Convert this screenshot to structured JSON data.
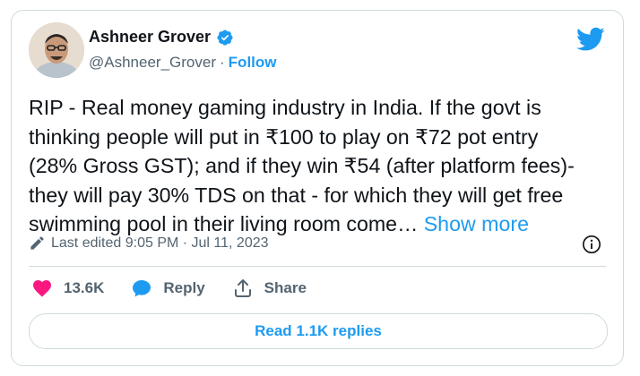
{
  "author": {
    "name": "Ashneer Grover",
    "handle": "@Ashneer_Grover",
    "separator": "·",
    "follow_label": "Follow"
  },
  "tweet": {
    "text": "RIP - Real money gaming industry in India. If the govt is\nthinking people will put in ₹100 to play on ₹72 pot entry\n(28% Gross GST); and if they win ₹54 (after platform fees)-\nthey will pay 30% TDS on that - for which they will get free\nswimming pool in their living room come… ",
    "show_more_label": "Show more"
  },
  "meta": {
    "edited_label": "Last edited 9:05 PM · Jul 11, 2023"
  },
  "actions": {
    "likes_count": "13.6K",
    "reply_label": "Reply",
    "share_label": "Share"
  },
  "replies_button_label": "Read 1.1K replies",
  "colors": {
    "accent": "#1d9bf0",
    "like": "#f91880",
    "muted": "#536471",
    "border": "#cfd9de"
  },
  "icons": [
    "verified-badge-icon",
    "twitter-bird-icon",
    "pencil-icon",
    "info-icon",
    "heart-icon",
    "speech-bubble-icon",
    "share-icon"
  ]
}
